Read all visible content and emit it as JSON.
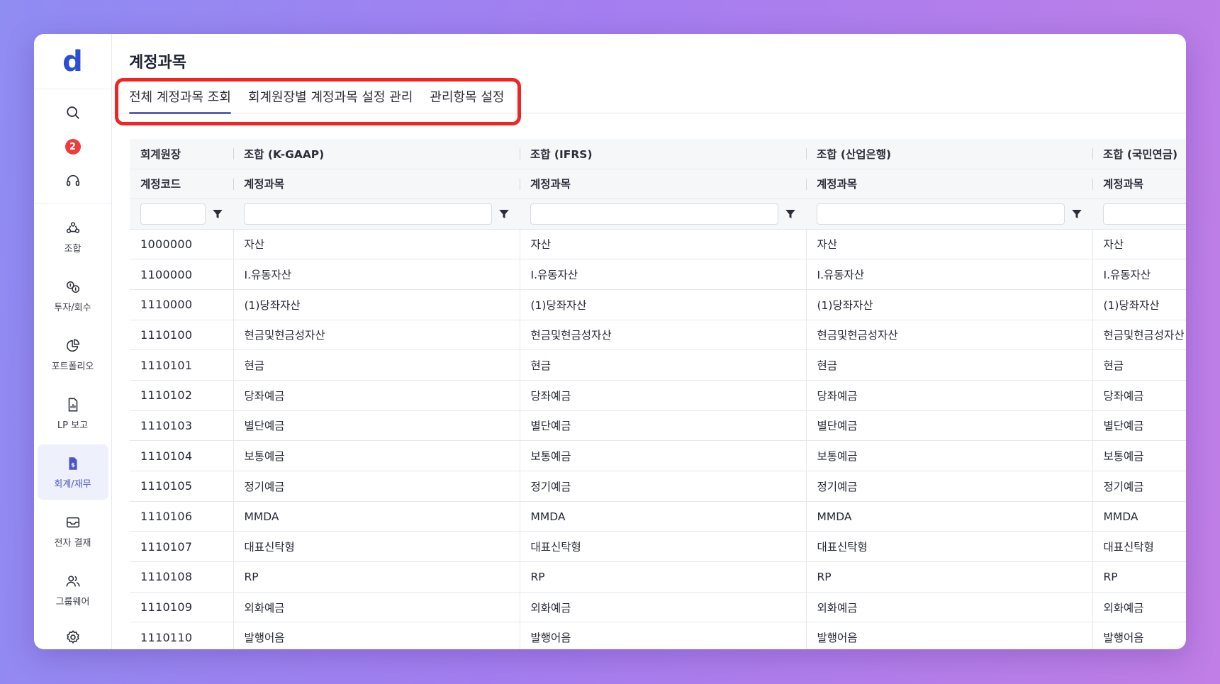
{
  "logo": {
    "text": "d"
  },
  "sidebar": {
    "notification_count": "2",
    "nav": [
      {
        "id": "combination",
        "label": "조합",
        "icon": "people-group-icon"
      },
      {
        "id": "invest",
        "label": "투자/회수",
        "icon": "invest-return-icon"
      },
      {
        "id": "portfolio",
        "label": "포트폴리오",
        "icon": "pie-chart-icon"
      },
      {
        "id": "lp-report",
        "label": "LP 보고",
        "icon": "report-document-icon"
      },
      {
        "id": "accounting",
        "label": "회계/재무",
        "icon": "dollar-document-icon",
        "active": true
      },
      {
        "id": "e-approval",
        "label": "전자 결재",
        "icon": "inbox-tray-icon"
      },
      {
        "id": "groupware",
        "label": "그룹웨어",
        "icon": "users-icon"
      }
    ]
  },
  "page": {
    "title": "계정과목"
  },
  "tabs": [
    {
      "label": "전체 계정과목 조회",
      "active": true
    },
    {
      "label": "회계원장별 계정과목 설정 관리",
      "active": false
    },
    {
      "label": "관리항목 설정",
      "active": false
    }
  ],
  "table": {
    "ledger_header": [
      "회계원장",
      "조합 (K-GAAP)",
      "조합 (IFRS)",
      "조합 (산업은행)",
      "조합 (국민연금)"
    ],
    "column_header": [
      "계정코드",
      "계정과목",
      "계정과목",
      "계정과목",
      "계정과목"
    ],
    "rows": [
      [
        "1000000",
        "자산",
        "자산",
        "자산",
        "자산"
      ],
      [
        "1100000",
        "I.유동자산",
        "I.유동자산",
        "I.유동자산",
        "I.유동자산"
      ],
      [
        "1110000",
        "(1)당좌자산",
        "(1)당좌자산",
        "(1)당좌자산",
        "(1)당좌자산"
      ],
      [
        "1110100",
        "현금및현금성자산",
        "현금및현금성자산",
        "현금및현금성자산",
        "현금및현금성자산"
      ],
      [
        "1110101",
        "현금",
        "현금",
        "현금",
        "현금"
      ],
      [
        "1110102",
        "당좌예금",
        "당좌예금",
        "당좌예금",
        "당좌예금"
      ],
      [
        "1110103",
        "별단예금",
        "별단예금",
        "별단예금",
        "별단예금"
      ],
      [
        "1110104",
        "보통예금",
        "보통예금",
        "보통예금",
        "보통예금"
      ],
      [
        "1110105",
        "정기예금",
        "정기예금",
        "정기예금",
        "정기예금"
      ],
      [
        "1110106",
        "MMDA",
        "MMDA",
        "MMDA",
        "MMDA"
      ],
      [
        "1110107",
        "대표신탁형",
        "대표신탁형",
        "대표신탁형",
        "대표신탁형"
      ],
      [
        "1110108",
        "RP",
        "RP",
        "RP",
        "RP"
      ],
      [
        "1110109",
        "외화예금",
        "외화예금",
        "외화예금",
        "외화예금"
      ],
      [
        "1110110",
        "발행어음",
        "발행어음",
        "발행어음",
        "발행어음"
      ]
    ]
  },
  "colors": {
    "highlight": "#f02424",
    "accent": "#4a55c8",
    "badge": "#ef3b3b"
  }
}
